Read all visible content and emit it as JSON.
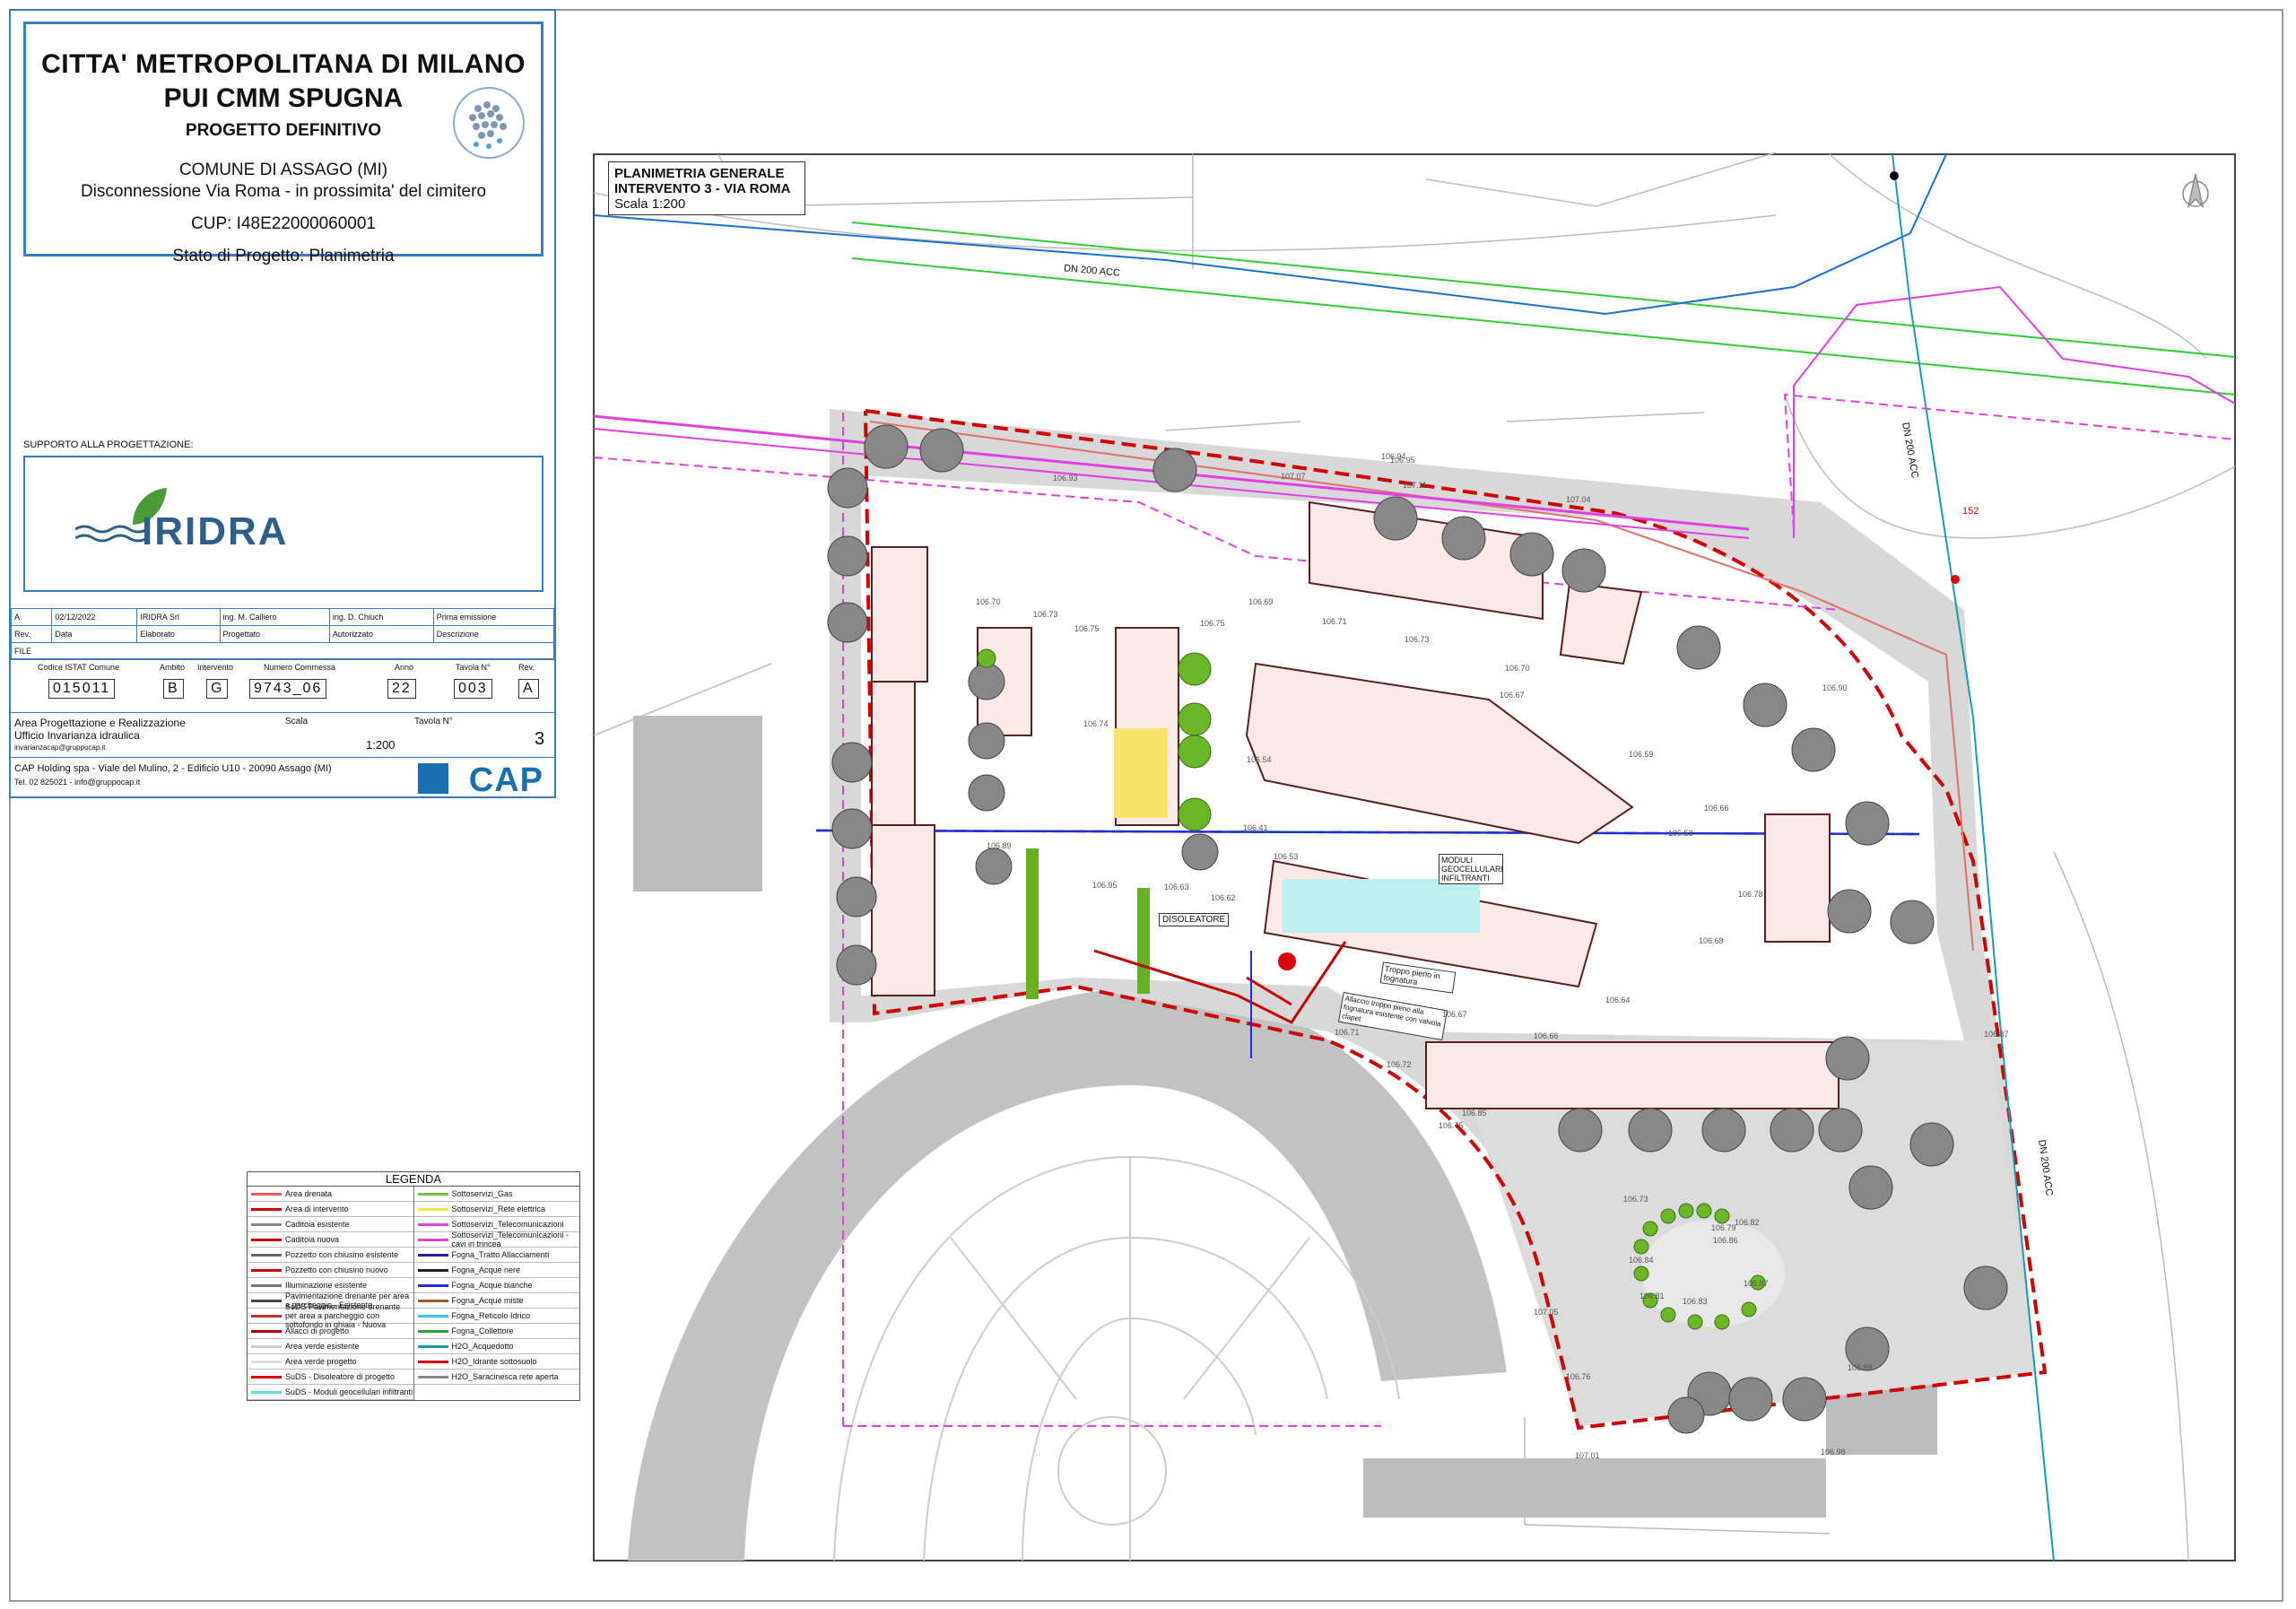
{
  "title_block": {
    "line1": "CITTA' METROPOLITANA DI MILANO",
    "line2": "PUI CMM SPUGNA",
    "line3": "PROGETTO DEFINITIVO",
    "comune": "COMUNE DI ASSAGO (MI)",
    "descr": "Disconnessione Via Roma - in prossimita' del cimitero",
    "cup": "CUP: I48E22000060001",
    "stato": "Stato di Progetto: Planimetria",
    "supporto": "SUPPORTO ALLA PROGETTAZIONE:",
    "iridra": "IRIDRA",
    "rev_row": [
      "A",
      "02/12/2022",
      "IRIDRA Srl",
      "ing. M. Calliero",
      "ing. D. Chiuch",
      "Prima emissione"
    ],
    "rev_head": [
      "Rev.",
      "Data",
      "Elaborato",
      "Progettato",
      "Autorizzato",
      "Descrizione"
    ],
    "file": "FILE",
    "codes_labels": [
      "Codice ISTAT Comune",
      "Ambito",
      "Intervento",
      "Numero Commessa",
      "Anno",
      "Tavola N°",
      "Rev."
    ],
    "codes_values": [
      "015011",
      "B",
      "G",
      "9743_06",
      "22",
      "003",
      "A"
    ],
    "area1": "Area Progettazione e Realizzazione",
    "area2": "Ufficio Invarianza idraulica",
    "area_mail": "invarianzacap@gruppocap.it",
    "scala_label": "Scala",
    "scala_value": "1:200",
    "tavola_label": "Tavola N°",
    "tavola_value": "3",
    "cap_addr": "CAP Holding spa - Viale del Mulino, 2 - Edificio U10 - 20090 Assago (MI)",
    "cap_tel": "Tel. 02 825021 - info@gruppocap.it",
    "cap_logo": "CAP"
  },
  "plan": {
    "title1": "PLANIMETRIA GENERALE",
    "title2": "INTERVENTO 3 - VIA ROMA",
    "scale": "Scala 1:200",
    "dn1": "DN 200 ACC",
    "dn2": "DN 200 ACC",
    "dn3": "DN 200 ACC",
    "label_disoleatore": "DISOLEATORE",
    "label_moduli": "MODULI GEOCELLULARI INFILTRANTI",
    "label_troppo": "Troppo pieno in fognatura",
    "label_allaccio": "Allaccio troppo pieno alla fognatura esistente con valvola clapet",
    "marker152": "152"
  },
  "legend": {
    "title": "LEGENDA",
    "left": [
      {
        "label": "Area drenata",
        "color": "#e06060"
      },
      {
        "label": "Area di intervento",
        "color": "#d00000"
      },
      {
        "label": "Caditoia esistente",
        "color": "#888888"
      },
      {
        "label": "Caditoia nuova",
        "color": "#cc0000"
      },
      {
        "label": "Pozzetto con chiusino esistente",
        "color": "#666666"
      },
      {
        "label": "Pozzetto con chiusino nuovo",
        "color": "#cc0000"
      },
      {
        "label": "Illuminazione esistente",
        "color": "#777777"
      },
      {
        "label": "Pavimentazione drenante per area a parcheggio - Esistente",
        "color": "#444444"
      },
      {
        "label": "SuDS Pavimentazione drenante per area a parcheggio con sottofondo in ghiaia - Nuova",
        "color": "#c03030"
      },
      {
        "label": "Allacci di progetto",
        "color": "#c00000"
      },
      {
        "label": "Area verde esistente",
        "color": "#cccccc"
      },
      {
        "label": "Area verde progetto",
        "color": "#dddddd"
      },
      {
        "label": "SuDS - Disoleatore di progetto",
        "color": "#dd0000"
      },
      {
        "label": "SuDS - Moduli geocellulari infiltranti",
        "color": "#66dddd"
      }
    ],
    "right": [
      {
        "label": "Sottoservizi_Gas",
        "color": "#7ac142"
      },
      {
        "label": "Sottoservizi_Rete elettrica",
        "color": "#f2e24a"
      },
      {
        "label": "Sottoservizi_Telecomunicazioni",
        "color": "#e040e0"
      },
      {
        "label": "Sottoservizi_Telecomunicazioni - cavi in trincea",
        "color": "#e040e0"
      },
      {
        "label": "Fogna_Tratto Allacciamenti",
        "color": "#2020a0"
      },
      {
        "label": "Fogna_Acque nere",
        "color": "#222222"
      },
      {
        "label": "Fogna_Acque bianche",
        "color": "#2030d0"
      },
      {
        "label": "Fogna_Acque miste",
        "color": "#a05a20"
      },
      {
        "label": "Fogna_Reticolo Idrico",
        "color": "#40c0f0"
      },
      {
        "label": "Fogna_Collettore",
        "color": "#30a030"
      },
      {
        "label": "H2O_Acquedotto",
        "color": "#1a9ab0"
      },
      {
        "label": "H2O_Idrante sottosuolo",
        "color": "#dd0000"
      },
      {
        "label": "H2O_Saracinesca rete aperta",
        "color": "#888888"
      }
    ]
  },
  "elevations": [
    "106.70",
    "106.73",
    "106.75",
    "106.75",
    "106.74",
    "106.69",
    "106.71",
    "106.73",
    "106.70",
    "106.67",
    "106.59",
    "106.54",
    "106.53",
    "106.66",
    "106.53",
    "106.41",
    "106.95",
    "106.63",
    "106.62",
    "106.68",
    "106.64",
    "106.67",
    "106.72",
    "106.66",
    "106.71",
    "106.78",
    "106.89",
    "106.90",
    "107.04",
    "107.07",
    "107.11",
    "106.94",
    "106.95",
    "106.93",
    "106.85",
    "106.87",
    "106.75",
    "106.73",
    "106.86",
    "106.87",
    "106.83",
    "106.84",
    "106.82",
    "106.81",
    "106.79",
    "106.76",
    "107.01",
    "107.05",
    "106.98",
    "106.89"
  ]
}
